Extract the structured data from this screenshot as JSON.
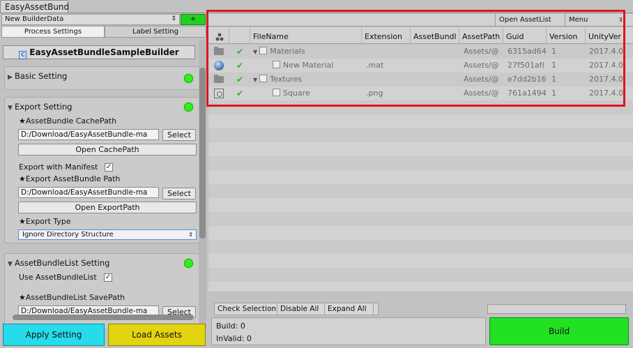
{
  "window": {
    "tab_title": "EasyAssetBund"
  },
  "builder": {
    "selected": "New BuilderData",
    "add_label": "+"
  },
  "tabs": {
    "process": "Process Settings",
    "label": "Label Setting"
  },
  "title": "EasyAssetBundleSampleBuilder",
  "basic": {
    "label": "Basic Setting",
    "status_color": "#33ee22"
  },
  "export": {
    "label": "Export Setting",
    "cache_path_label": "★AssetBundle CachePath",
    "cache_path_value": "D:/Download/EasyAssetBundle-ma",
    "select_label": "Select",
    "open_cache_label": "Open CachePath",
    "manifest_label": "Export with Manifest",
    "manifest_checked": true,
    "export_path_label": "★Export AssetBundle Path",
    "export_path_value": "D:/Download/EasyAssetBundle-ma",
    "open_export_label": "Open ExportPath",
    "export_type_label": "★Export Type",
    "export_type_value": "Ignore Directory Structure"
  },
  "abl": {
    "label": "AssetBundleList Setting",
    "use_label": "Use AssetBundleList",
    "use_checked": true,
    "save_path_label": "★AssetBundleList SavePath",
    "save_path_value": "D:/Download/EasyAssetBundle-ma",
    "select_label": "Select"
  },
  "actions": {
    "apply": "Apply Setting",
    "load": "Load Assets",
    "build": "Build"
  },
  "toolbar": {
    "open_list": "Open AssetList",
    "menu": "Menu"
  },
  "columns": [
    "FileName",
    "Extension",
    "AssetBundl",
    "AssetPath",
    "Guid",
    "Version",
    "UnityVer"
  ],
  "rows": [
    {
      "icon": "folder-icon",
      "name": "Materials",
      "ext": "",
      "path": "Assets/@",
      "guid": "6315ad64",
      "version": "1",
      "unity": "2017.4.0",
      "folder": true
    },
    {
      "icon": "material-sphere-icon",
      "name": "New Material",
      "ext": ".mat",
      "path": "Assets/@",
      "guid": "27f501af(",
      "version": "1",
      "unity": "2017.4.0",
      "folder": false
    },
    {
      "icon": "folder-icon",
      "name": "Textures",
      "ext": "",
      "path": "Assets/@",
      "guid": "e7dd2b16",
      "version": "1",
      "unity": "2017.4.0",
      "folder": true
    },
    {
      "icon": "texture-icon",
      "name": "Square",
      "ext": ".png",
      "path": "Assets/@",
      "guid": "761a1494",
      "version": "1",
      "unity": "2017.4.0",
      "folder": false
    }
  ],
  "footer": {
    "check_selection": "Check Selection",
    "disable_all": "Disable All",
    "expand_all": "Expand All"
  },
  "status": {
    "build": "Build: 0",
    "invalid": "InValid: 0"
  }
}
